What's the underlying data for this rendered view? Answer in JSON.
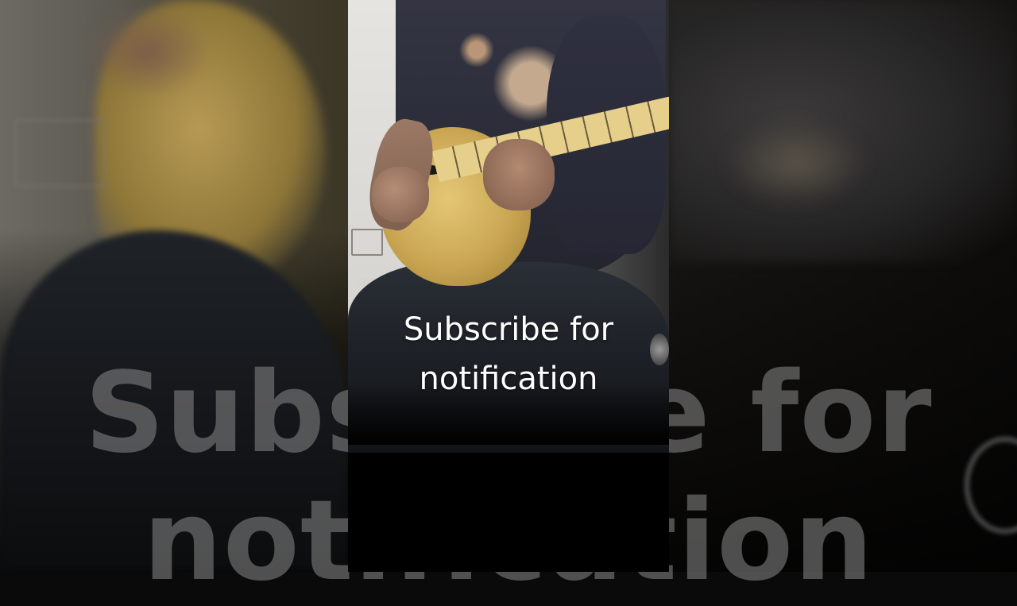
{
  "caption": {
    "line1": "Subscribe for",
    "line2": "notification"
  },
  "colors": {
    "caption_text": "#ffffff",
    "ghost_text": "#7d7d7d",
    "letterbox": "#000000",
    "guitar_body": "#caa653"
  }
}
